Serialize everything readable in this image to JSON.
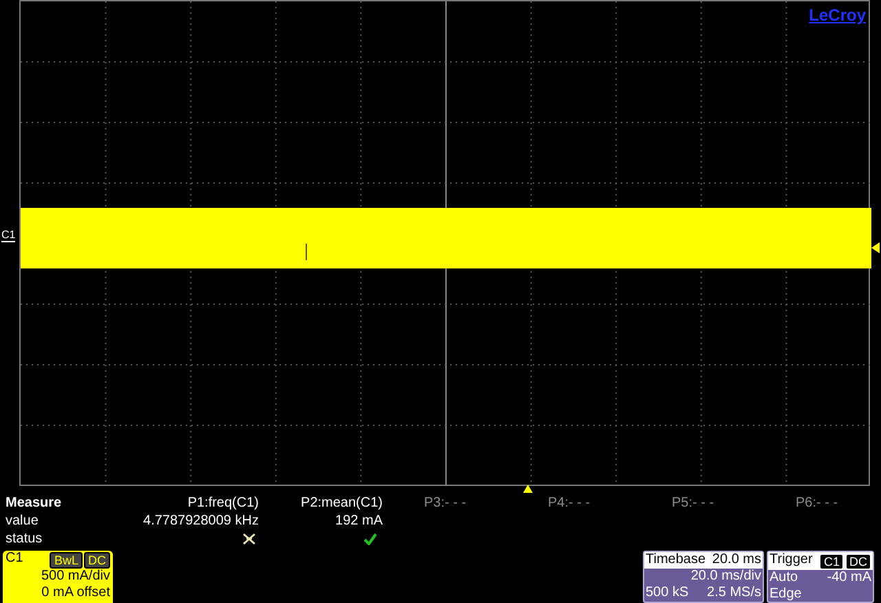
{
  "brand": "LeCroy",
  "channel_marker": "C1",
  "measure": {
    "title": "Measure",
    "row_labels": [
      "value",
      "status"
    ],
    "params": [
      {
        "label": "P1:freq(C1)",
        "value": "4.7787928009 kHz",
        "valid": false
      },
      {
        "label": "P2:mean(C1)",
        "value": "192 mA",
        "valid": true
      },
      {
        "label": "P3:- - -"
      },
      {
        "label": "P4:- - -"
      },
      {
        "label": "P5:- - -"
      },
      {
        "label": "P6:- - -"
      }
    ]
  },
  "channel": {
    "name": "C1",
    "badges": [
      "BwL",
      "DC"
    ],
    "scale": "500 mA/div",
    "offset": "0 mA offset"
  },
  "timebase": {
    "title": "Timebase",
    "delay": "20.0 ms",
    "scale": "20.0 ms/div",
    "samples": "500 kS",
    "rate": "2.5 MS/s"
  },
  "trigger": {
    "title": "Trigger",
    "badges": [
      "C1",
      "DC"
    ],
    "mode": "Auto",
    "level": "-40 mA",
    "type": "Edge"
  }
}
